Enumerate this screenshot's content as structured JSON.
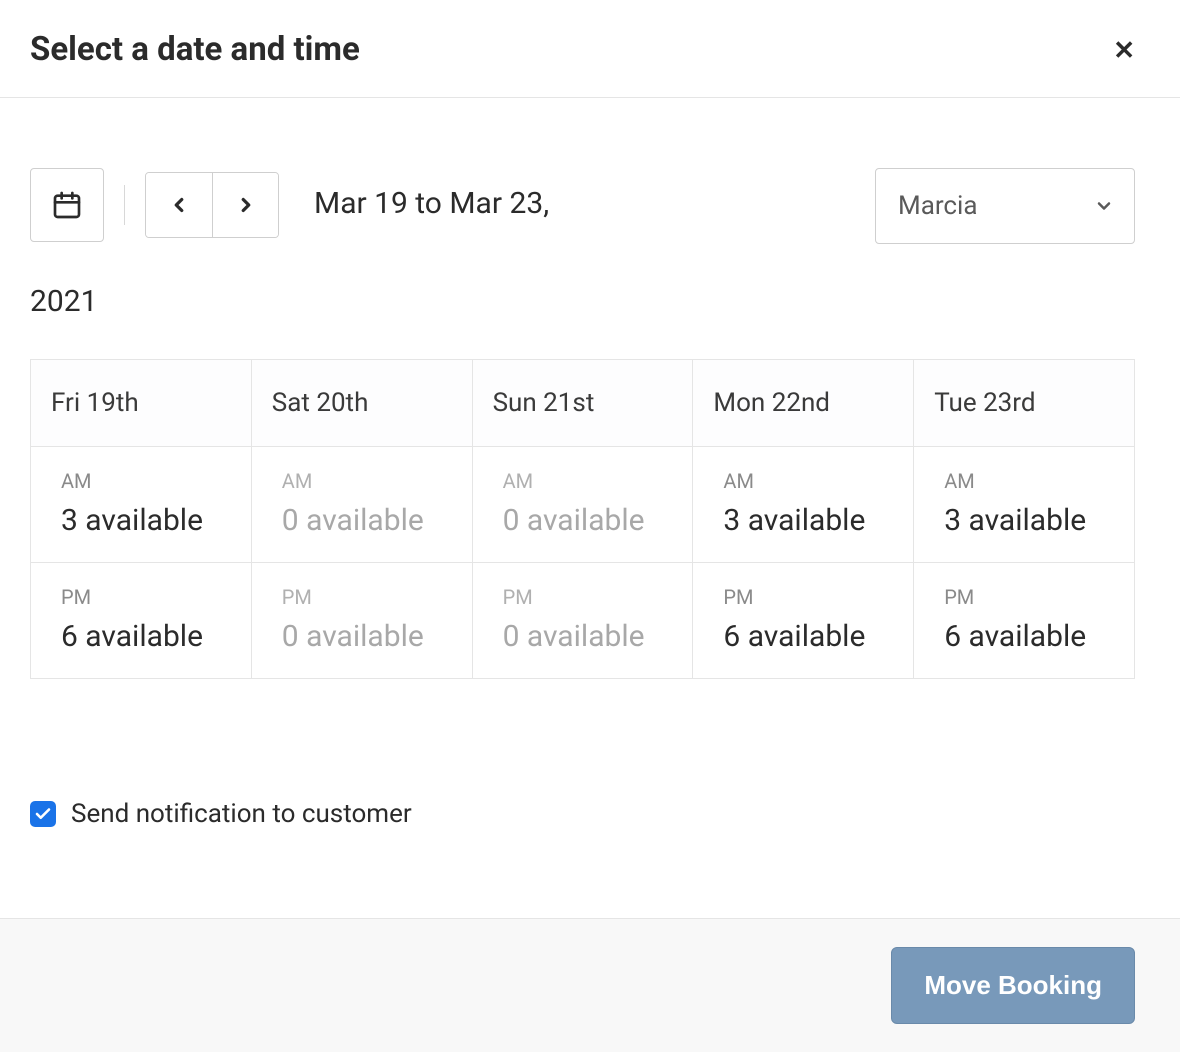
{
  "header": {
    "title": "Select a date and time"
  },
  "toolbar": {
    "date_range": "Mar 19 to Mar 23,",
    "year": "2021",
    "staff_select": {
      "value": "Marcia"
    }
  },
  "table": {
    "columns": [
      "Fri 19th",
      "Sat 20th",
      "Sun 21st",
      "Mon 22nd",
      "Tue 23rd"
    ],
    "rows": [
      {
        "period": "AM",
        "cells": [
          {
            "text": "3 available",
            "zero": false
          },
          {
            "text": "0 available",
            "zero": true
          },
          {
            "text": "0 available",
            "zero": true
          },
          {
            "text": "3 available",
            "zero": false
          },
          {
            "text": "3 available",
            "zero": false
          }
        ]
      },
      {
        "period": "PM",
        "cells": [
          {
            "text": "6 available",
            "zero": false
          },
          {
            "text": "0 available",
            "zero": true
          },
          {
            "text": "0 available",
            "zero": true
          },
          {
            "text": "6 available",
            "zero": false
          },
          {
            "text": "6 available",
            "zero": false
          }
        ]
      }
    ]
  },
  "notification": {
    "label": "Send notification to customer",
    "checked": true
  },
  "footer": {
    "primary_button": "Move Booking"
  }
}
